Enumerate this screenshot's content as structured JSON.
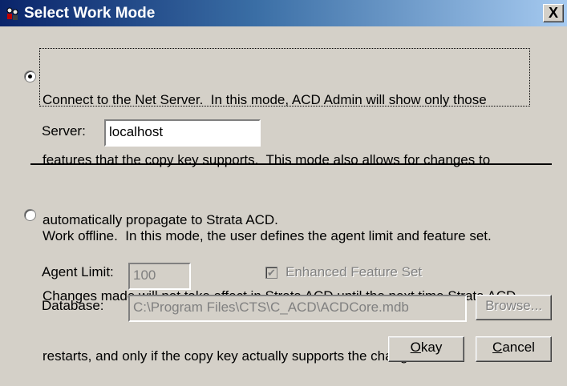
{
  "window": {
    "title": "Select Work Mode",
    "close_label": "X"
  },
  "online_mode": {
    "selected": true,
    "description_lines": [
      "Connect to the Net Server.  In this mode, ACD Admin will show only those",
      "features that the copy key supports.  This mode also allows for changes to",
      "automatically propagate to Strata ACD."
    ],
    "server_label": "Server:",
    "server_value": "localhost"
  },
  "offline_mode": {
    "selected": false,
    "description_lines": [
      "Work offline.  In this mode, the user defines the agent limit and feature set.",
      "Changes made will not take affect in Strata ACD until the next time Strata ACD",
      "restarts, and only if the copy key actually supports the changes made."
    ],
    "agent_limit_label": "Agent Limit:",
    "agent_limit_value": "100",
    "enhanced_label": "Enhanced Feature Set",
    "enhanced_checked": true,
    "database_label": "Database:",
    "database_value": "C:\\Program Files\\CTS\\C_ACD\\ACDCore.mdb",
    "browse_label": "Browse..."
  },
  "buttons": {
    "okay_label": "Okay",
    "cancel_label": "Cancel"
  }
}
